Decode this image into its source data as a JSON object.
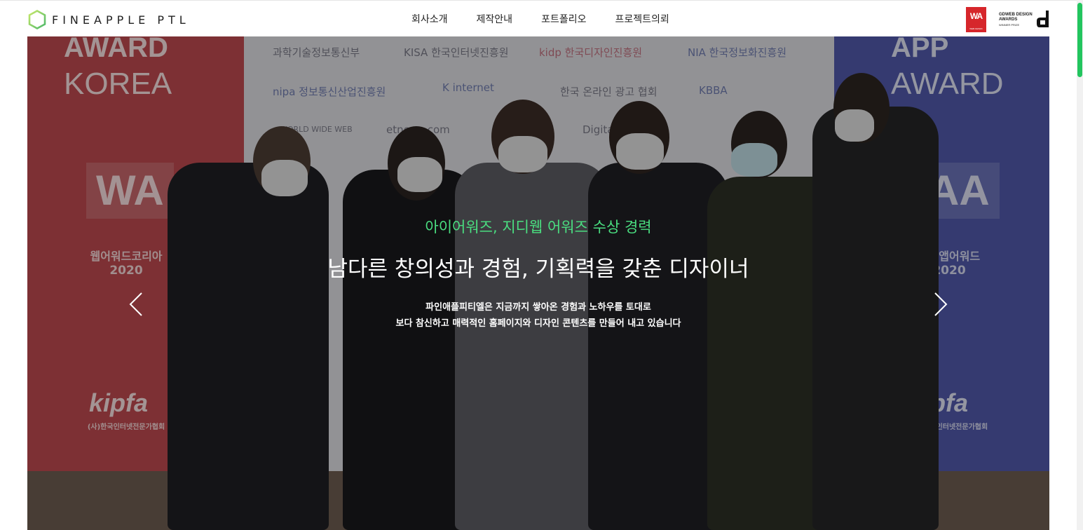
{
  "header": {
    "logo_text": "FINEAPPLE PTL",
    "nav": [
      {
        "label": "회사소개"
      },
      {
        "label": "제작안내"
      },
      {
        "label": "포트폴리오"
      },
      {
        "label": "프로젝트의뢰"
      }
    ],
    "awards": {
      "wa_mark": "WA",
      "wa_caption": "WEB AWARD",
      "gd_title": "GDWEB DESIGN AWARDS",
      "gd_caption": "WINNER PRIZE"
    }
  },
  "hero": {
    "subtitle": "아이어워즈, 지디웹 어워즈 수상 경력",
    "title": "남다른 창의성과 경험, 기획력을 갖춘 디자이너",
    "desc_line1": "파인애플피티엘은 지금까지 쌓아온 경험과 노하우를 토대로",
    "desc_line2": "보다 참신하고 매력적인 홈페이지와 디자인 콘텐츠를 만들어 내고 있습니다",
    "backdrop": {
      "left_panel": {
        "line1": "AWARD",
        "line2": "KOREA",
        "mark": "WA",
        "name": "웹어워드코리아",
        "year": "2020",
        "org": "kipfa",
        "org_sub": "(사)한국인터넷전문가협회"
      },
      "right_panel": {
        "line1": "APP",
        "line2": "AWARD",
        "mark": "AA",
        "name": "마트앱어워드",
        "year": "2020",
        "org": "kipfa",
        "org_sub": "(사)한국인터넷전문가협회"
      },
      "sponsors": [
        "과학기술정보통신부",
        "KISA 한국인터넷진흥원",
        "kidp 한국디자인진흥원",
        "NIA 한국정보화진흥원",
        "nipa 정보통신산업진흥원",
        "K internet",
        "한국 온라인 광고 협회",
        "KBBA",
        "WORLD WIDE WEB",
        "etnews.com",
        "Digital Daily"
      ]
    }
  },
  "colors": {
    "accent_green": "#4ade80",
    "logo_green": "#8fd14f",
    "scroll_thumb": "#22c55e",
    "award_red": "#d6262b"
  },
  "icons": {
    "prev": "chevron-left-icon",
    "next": "chevron-right-icon"
  }
}
